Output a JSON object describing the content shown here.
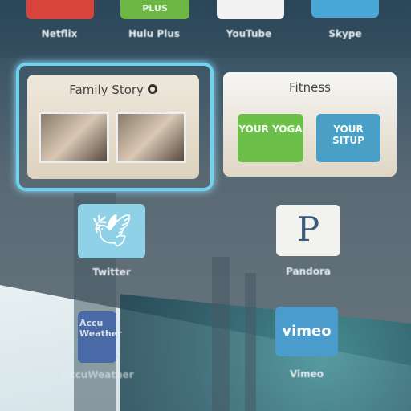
{
  "top_row": [
    {
      "label": "Netflix",
      "color": "#d9433c"
    },
    {
      "label": "Hulu Plus",
      "color": "#6cb744",
      "tile_text": "PLUS"
    },
    {
      "label": "YouTube",
      "color": "#f2f2f2"
    },
    {
      "label": "Skype",
      "color": "#4aa8d8"
    }
  ],
  "family_story": {
    "title": "Family Story",
    "icon": "circle-icon",
    "selected": true,
    "accent": "#6fd3f0"
  },
  "fitness": {
    "title": "Fitness",
    "tiles": [
      {
        "text": "YOUR YOGA",
        "color": "#6cc04a"
      },
      {
        "text": "YOUR SITUP",
        "color": "#4a9fc6"
      }
    ]
  },
  "apps": [
    {
      "label": "Twitter",
      "icon": "twitter-bird-icon",
      "color": "#8fd2e8"
    },
    {
      "label": "Pandora",
      "icon_text": "P",
      "color": "#f2f2ee"
    },
    {
      "label": "AccuWeather",
      "icon_text": "Accu Weather",
      "color": "#3a5fa8"
    },
    {
      "label": "Vimeo",
      "icon_text": "vimeo",
      "color": "#4a9ccc"
    }
  ]
}
